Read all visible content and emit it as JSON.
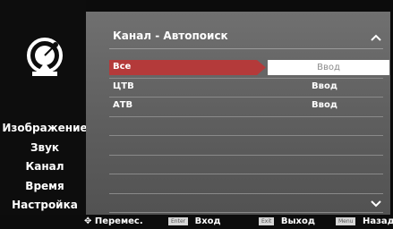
{
  "sidebar": {
    "icon": "satellite-dish-icon",
    "items": [
      {
        "label": "Изображение"
      },
      {
        "label": "Звук"
      },
      {
        "label": "Канал"
      },
      {
        "label": "Время"
      },
      {
        "label": "Настройка"
      }
    ]
  },
  "panel": {
    "title": "Канал - Автопоиск",
    "rows": [
      {
        "label": "Все",
        "value": "Ввод",
        "selected": true
      },
      {
        "label": "ЦТВ",
        "value": "Ввод"
      },
      {
        "label": "АТВ",
        "value": "Ввод"
      },
      {
        "label": "",
        "value": ""
      },
      {
        "label": "",
        "value": ""
      },
      {
        "label": "",
        "value": ""
      },
      {
        "label": "",
        "value": ""
      },
      {
        "label": "",
        "value": ""
      }
    ]
  },
  "footer": {
    "move": "Перемес.",
    "enter_key": "Enter",
    "enter": "Вход",
    "exit_key": "Exit",
    "exit": "Выход",
    "menu_key": "Menu",
    "back": "Назад"
  },
  "colors": {
    "panel": "#686868",
    "selected_label": "#b43a3a"
  }
}
